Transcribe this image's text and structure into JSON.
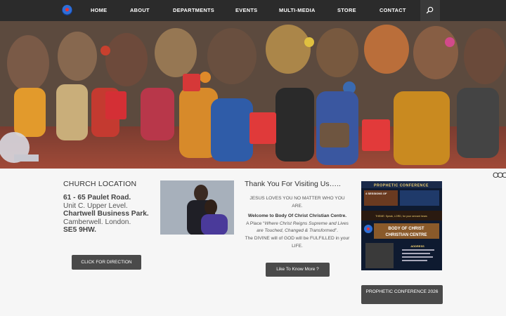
{
  "nav": {
    "items": [
      {
        "label": "HOME",
        "name": "nav-home"
      },
      {
        "label": "ABOUT",
        "name": "nav-about"
      },
      {
        "label": "DEPARTMENTS",
        "name": "nav-departments"
      },
      {
        "label": "EVENTS",
        "name": "nav-events"
      },
      {
        "label": "MULTI-MEDIA",
        "name": "nav-multimedia"
      },
      {
        "label": "STORE",
        "name": "nav-store"
      },
      {
        "label": "CONTACT",
        "name": "nav-contact"
      }
    ],
    "search_icon": "search-icon",
    "logo_icon": "church-logo-icon"
  },
  "hero": {
    "description_icon": "congregation-photo"
  },
  "carousel": {
    "dots": "OOO"
  },
  "location": {
    "title": "CHURCH LOCATION",
    "line1": "61 - 65 Paulet Road.",
    "line2": "Unit C. Upper Level.",
    "line3": "Chartwell Business Park.",
    "line4": "Camberwell. London.",
    "line5": "SE5 9HW.",
    "button": "CLICK FOR DIRECTION"
  },
  "welcome": {
    "title": "Thank You For Visiting Us…..",
    "line1": "JESUS LOVES YOU NO MATTER WHO YOU ARE.",
    "line2": "Welcome to Body Of Christ Christian Centre.",
    "line3_prefix": "A Place “",
    "line3_quote": "Where Christ Reigns Supreme and Lives are Touched, Changed & Transformed",
    "line3_suffix": "”.",
    "line4": "The DIVINE will of GOD will be FULFILLED in your LIFE.",
    "button": "Like To Know More ?"
  },
  "poster": {
    "header": "PROPHETIC CONFERENCE",
    "sessions": "4 SESSIONS OF",
    "theme": "THEME: Speak, LORD, for your servant hears",
    "name_line1": "BODY OF CHRIST",
    "name_line2": "CHRISTIAN CENTRE",
    "address_label": "ADDRESS",
    "button": "PROPHETIC CONFERENCE 2026"
  }
}
